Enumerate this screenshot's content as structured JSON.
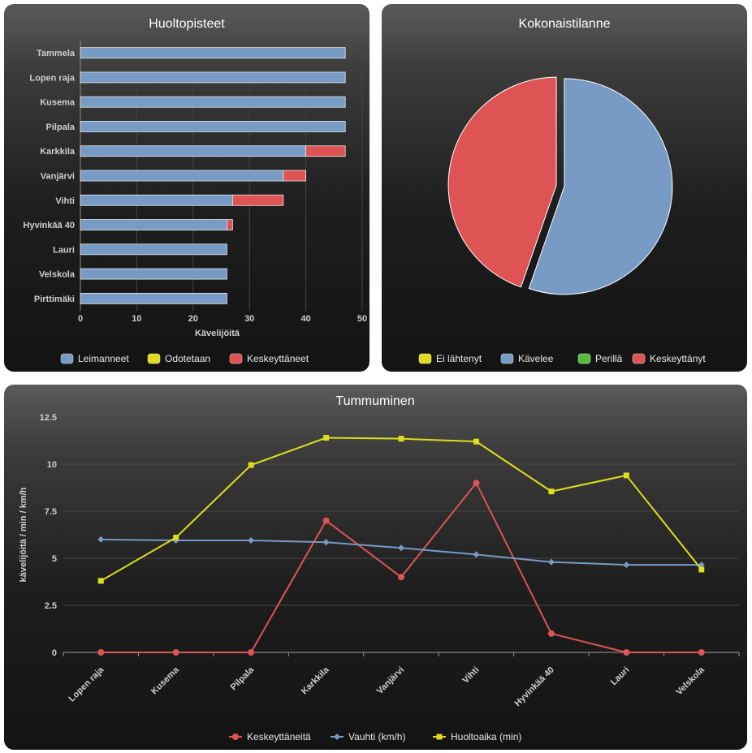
{
  "colors": {
    "blue": "#779bc4",
    "red": "#de5353",
    "yellow": "#dede1b",
    "green": "#55bf3b"
  },
  "chart_data": [
    {
      "type": "bar",
      "orientation": "horizontal",
      "stacked": true,
      "title": "Huoltopisteet",
      "categories": [
        "Tammela",
        "Lopen raja",
        "Kusema",
        "Pilpala",
        "Karkkila",
        "Vanjärvi",
        "Vihti",
        "Hyvinkää 40",
        "Lauri",
        "Velskola",
        "Pirttimäki"
      ],
      "series": [
        {
          "name": "Leimanneet",
          "color": "#779bc4",
          "values": [
            47,
            47,
            47,
            47,
            40,
            36,
            27,
            26,
            26,
            26,
            26
          ]
        },
        {
          "name": "Odotetaan",
          "color": "#dede1b",
          "values": [
            0,
            0,
            0,
            0,
            0,
            0,
            0,
            0,
            0,
            0,
            0
          ]
        },
        {
          "name": "Keskeyttäneet",
          "color": "#de5353",
          "values": [
            0,
            0,
            0,
            0,
            7,
            4,
            9,
            1,
            0,
            0,
            0
          ]
        }
      ],
      "xlabel": "Kävelijöitä",
      "xlim": [
        0,
        50
      ],
      "xticks": [
        0,
        10,
        20,
        30,
        40,
        50
      ],
      "legend": "bottom"
    },
    {
      "type": "pie",
      "title": "Kokonaistilanne",
      "labels": [
        "Ei lähtenyt",
        "Kävelee",
        "Perillä",
        "Keskeyttänyt"
      ],
      "colors": [
        "#dede1b",
        "#779bc4",
        "#55bf3b",
        "#de5353"
      ],
      "values": [
        0,
        26,
        0,
        21
      ],
      "legend": "bottom"
    },
    {
      "type": "line",
      "title": "Tummuminen",
      "categories": [
        "Lopen raja",
        "Kusema",
        "Pilpala",
        "Karkkila",
        "Vanjärvi",
        "Vihti",
        "Hyvinkää 40",
        "Lauri",
        "Velskola"
      ],
      "series": [
        {
          "name": "Keskeyttäneitä",
          "color": "#de5353",
          "marker": "circle",
          "values": [
            0,
            0,
            0,
            7,
            4,
            9,
            1,
            0,
            0
          ]
        },
        {
          "name": "Vauhti (km/h)",
          "color": "#779bc4",
          "marker": "diamond",
          "values": [
            6.0,
            5.95,
            5.95,
            5.85,
            5.55,
            5.2,
            4.8,
            4.65,
            4.65
          ]
        },
        {
          "name": "Huoltoaika (min)",
          "color": "#dede1b",
          "marker": "square",
          "values": [
            3.8,
            6.1,
            9.95,
            11.4,
            11.35,
            11.2,
            8.55,
            9.4,
            4.4
          ]
        }
      ],
      "ylabel": "kävelijöitä / min / km/h",
      "ylim": [
        0,
        12.5
      ],
      "yticks": [
        "0",
        "2.5",
        "5",
        "7.5",
        "10",
        "12.5"
      ],
      "legend": "bottom"
    }
  ]
}
